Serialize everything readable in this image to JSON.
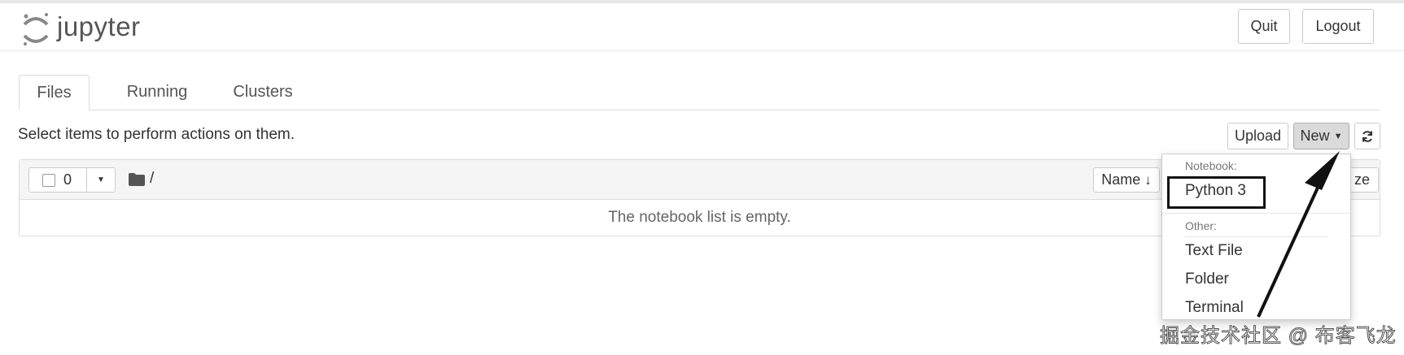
{
  "header": {
    "logo_text": "jupyter",
    "quit_label": "Quit",
    "logout_label": "Logout"
  },
  "tabs": [
    {
      "label": "Files",
      "active": true
    },
    {
      "label": "Running",
      "active": false
    },
    {
      "label": "Clusters",
      "active": false
    }
  ],
  "toolbar": {
    "hint": "Select items to perform actions on them.",
    "upload_label": "Upload",
    "new_label": "New",
    "refresh_icon": "refresh-icon"
  },
  "list": {
    "selected_count": "0",
    "breadcrumb": "/",
    "sort_label": "Name",
    "last_modified_partial": "ze",
    "empty_text": "The notebook list is empty."
  },
  "new_menu": {
    "notebook_header": "Notebook:",
    "python_label": "Python 3",
    "other_header": "Other:",
    "text_file_label": "Text File",
    "folder_label": "Folder",
    "terminal_label": "Terminal"
  },
  "watermark": "掘金技术社区 @ 布客飞龙",
  "colors": {
    "border": "#cccccc",
    "panel_bg": "#f5f5f5",
    "new_button_bg": "#dadada"
  }
}
